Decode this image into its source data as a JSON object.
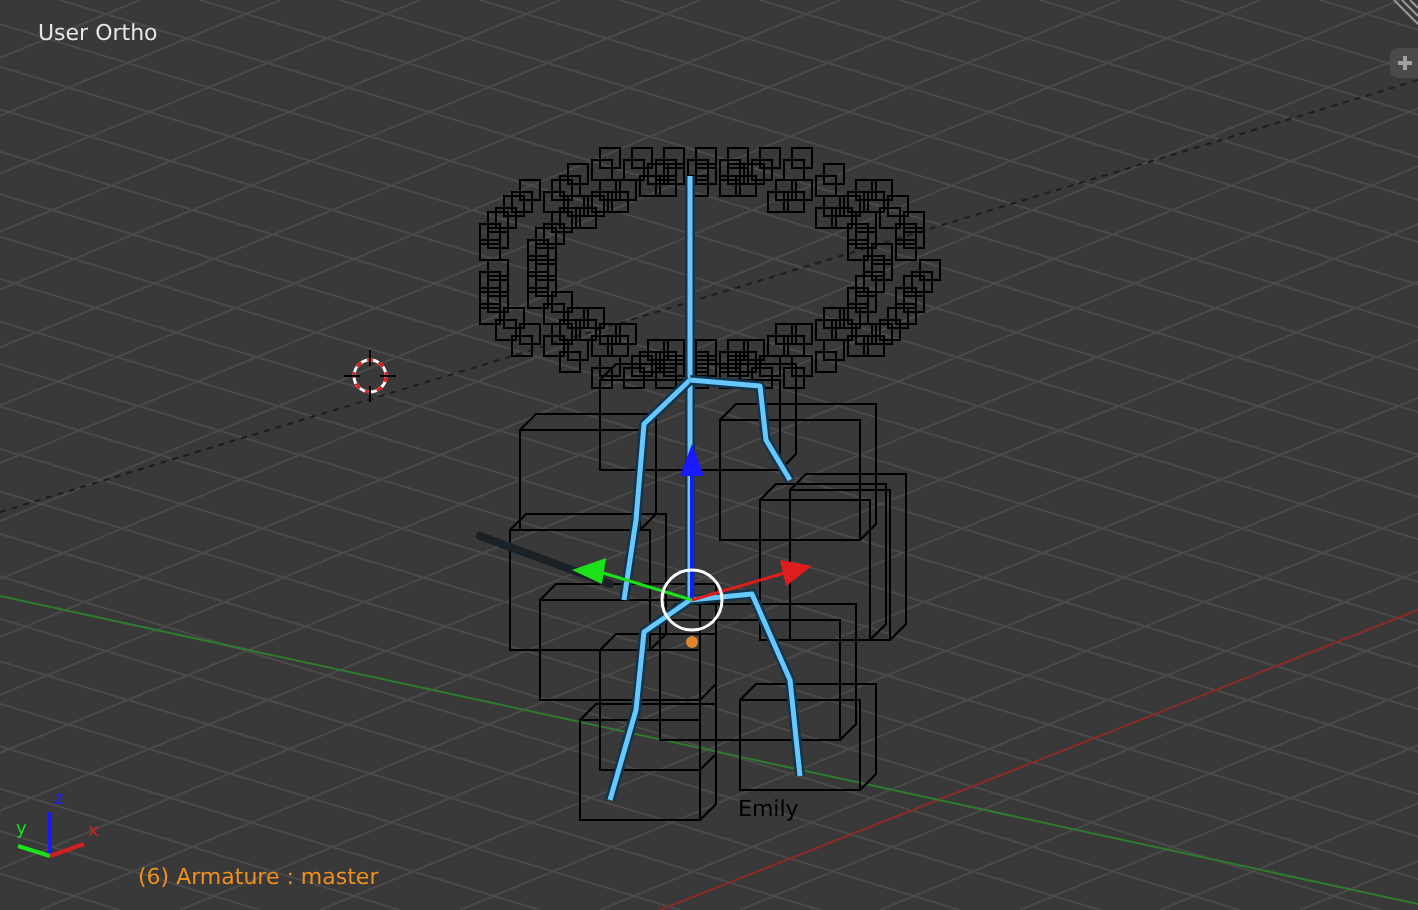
{
  "viewport": {
    "view_name": "User Ortho",
    "object_info": "(6) Armature : master",
    "object_label": "Emily"
  },
  "axis_gizmo": {
    "x_label": "x",
    "y_label": "y",
    "z_label": "z"
  }
}
